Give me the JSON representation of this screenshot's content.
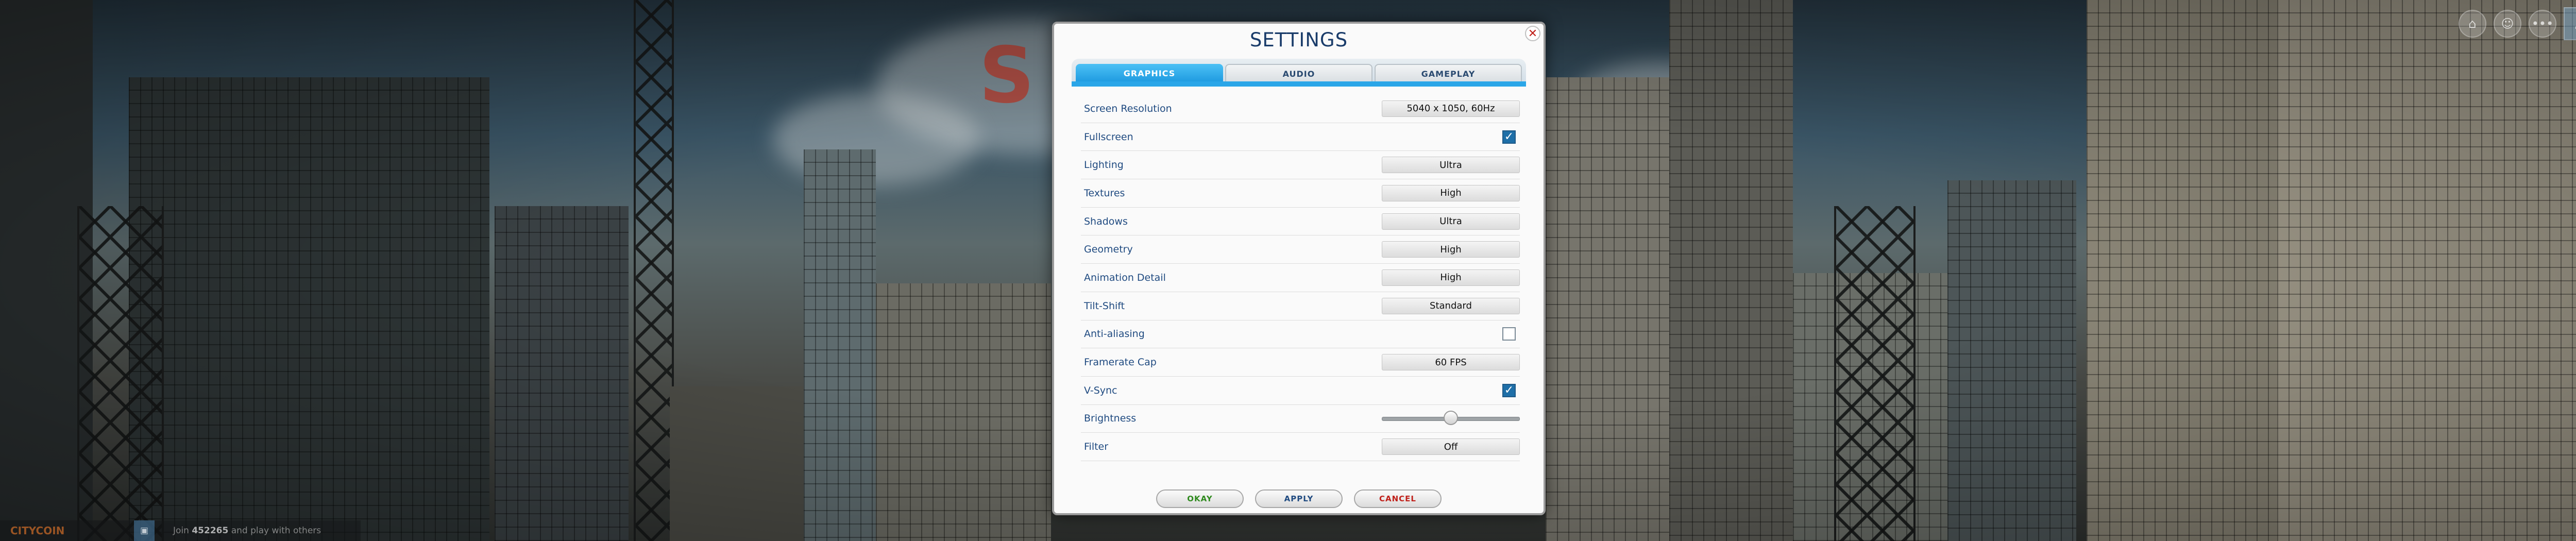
{
  "background": {
    "logo_text": "S",
    "bottom_bar": {
      "brand": "CITYCOIN",
      "text_prefix": "Join",
      "count": "452265",
      "text_suffix": "and play with others"
    }
  },
  "dialog": {
    "title": "SETTINGS",
    "close_symbol": "✕",
    "tabs": [
      {
        "label": "GRAPHICS",
        "active": true
      },
      {
        "label": "AUDIO",
        "active": false
      },
      {
        "label": "GAMEPLAY",
        "active": false
      }
    ],
    "settings": [
      {
        "label": "Screen Resolution",
        "type": "select",
        "value": "5040 x 1050, 60Hz"
      },
      {
        "label": "Fullscreen",
        "type": "checkbox",
        "checked": true
      },
      {
        "label": "Lighting",
        "type": "select",
        "value": "Ultra"
      },
      {
        "label": "Textures",
        "type": "select",
        "value": "High"
      },
      {
        "label": "Shadows",
        "type": "select",
        "value": "Ultra"
      },
      {
        "label": "Geometry",
        "type": "select",
        "value": "High"
      },
      {
        "label": "Animation Detail",
        "type": "select",
        "value": "High"
      },
      {
        "label": "Tilt-Shift",
        "type": "select",
        "value": "Standard"
      },
      {
        "label": "Anti-aliasing",
        "type": "checkbox",
        "checked": false
      },
      {
        "label": "Framerate Cap",
        "type": "select",
        "value": "60 FPS"
      },
      {
        "label": "V-Sync",
        "type": "checkbox",
        "checked": true
      },
      {
        "label": "Brightness",
        "type": "slider",
        "level": 0.5
      },
      {
        "label": "Filter",
        "type": "select",
        "value": "Off"
      }
    ],
    "buttons": {
      "okay": "OKAY",
      "apply": "APPLY",
      "cancel": "CANCEL"
    }
  },
  "top_icons": [
    "home-icon",
    "friends-icon",
    "more-icon",
    "profile-icon"
  ],
  "colors": {
    "accent": "#1e9ae0",
    "label": "#1f4a80",
    "okay": "#2f8a1e",
    "cancel": "#c0201a"
  }
}
